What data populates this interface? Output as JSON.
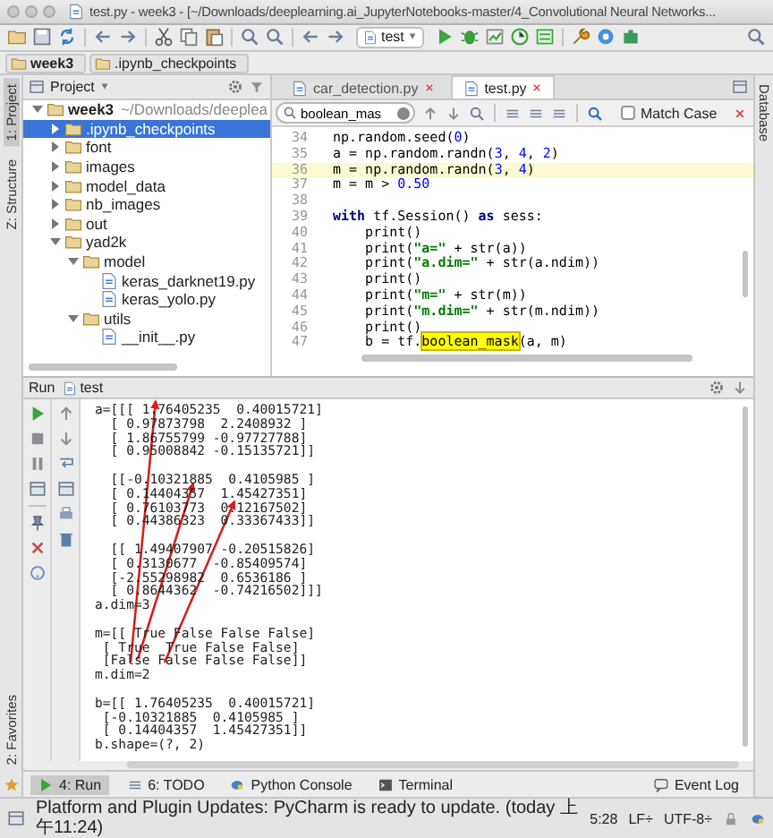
{
  "window": {
    "title": "test.py - week3 - [~/Downloads/deeplearning.ai_JupyterNotebooks-master/4_Convolutional Neural Networks..."
  },
  "toolbar": {
    "run_config": "test"
  },
  "breadcrumbs": [
    "week3",
    ".ipynb_checkpoints"
  ],
  "left_stripe": [
    {
      "label": "1: Project",
      "selected": true
    },
    {
      "label": "Z: Structure",
      "selected": false
    }
  ],
  "favorites": "2: Favorites",
  "right_stripe": [
    "Database"
  ],
  "project": {
    "title": "Project",
    "tree": [
      {
        "label": "week3",
        "path": "~/Downloads/deeplea",
        "kind": "folder",
        "expanded": true,
        "selected": false,
        "children": [
          {
            "label": ".ipynb_checkpoints",
            "kind": "folder",
            "expanded": false,
            "selected": true
          },
          {
            "label": "font",
            "kind": "folder",
            "expanded": false,
            "selected": false
          },
          {
            "label": "images",
            "kind": "folder",
            "expanded": false,
            "selected": false
          },
          {
            "label": "model_data",
            "kind": "folder",
            "expanded": false,
            "selected": false
          },
          {
            "label": "nb_images",
            "kind": "folder",
            "expanded": false,
            "selected": false
          },
          {
            "label": "out",
            "kind": "folder",
            "expanded": false,
            "selected": false
          },
          {
            "label": "yad2k",
            "kind": "folder",
            "expanded": true,
            "selected": false,
            "children": [
              {
                "label": "model",
                "kind": "folder",
                "expanded": true,
                "selected": false,
                "children": [
                  {
                    "label": "keras_darknet19.py",
                    "kind": "file",
                    "selected": false
                  },
                  {
                    "label": "keras_yolo.py",
                    "kind": "file",
                    "selected": false
                  }
                ]
              },
              {
                "label": "utils",
                "kind": "folder",
                "expanded": true,
                "selected": false,
                "children": [
                  {
                    "label": "__init__.py",
                    "kind": "file",
                    "selected": false
                  }
                ]
              }
            ]
          }
        ]
      }
    ]
  },
  "editor_tabs": [
    {
      "label": "car_detection.py",
      "selected": false
    },
    {
      "label": "test.py",
      "selected": true
    }
  ],
  "search": {
    "value": "boolean_mas",
    "match_case": {
      "label": "Match Case",
      "checked": false
    }
  },
  "code": [
    {
      "number": "34",
      "current": false,
      "tokens": [
        {
          "kind": "plain",
          "text": "np.random.seed("
        },
        {
          "kind": "number",
          "text": "0"
        },
        {
          "kind": "plain",
          "text": ")"
        }
      ]
    },
    {
      "number": "35",
      "current": false,
      "tokens": [
        {
          "kind": "plain",
          "text": "a = np.random.randn("
        },
        {
          "kind": "number",
          "text": "3"
        },
        {
          "kind": "plain",
          "text": ", "
        },
        {
          "kind": "number",
          "text": "4"
        },
        {
          "kind": "plain",
          "text": ", "
        },
        {
          "kind": "number",
          "text": "2"
        },
        {
          "kind": "plain",
          "text": ")"
        }
      ]
    },
    {
      "number": "36",
      "current": true,
      "tokens": [
        {
          "kind": "plain",
          "text": "m = np.random.randn("
        },
        {
          "kind": "number",
          "text": "3"
        },
        {
          "kind": "plain",
          "text": ", "
        },
        {
          "kind": "number",
          "text": "4"
        },
        {
          "kind": "plain",
          "text": ")"
        }
      ]
    },
    {
      "number": "37",
      "current": false,
      "tokens": [
        {
          "kind": "plain",
          "text": "m = m > "
        },
        {
          "kind": "number",
          "text": "0.50"
        }
      ]
    },
    {
      "number": "38",
      "current": false
    },
    {
      "number": "39",
      "current": false,
      "tokens": [
        {
          "kind": "keyword",
          "text": "with"
        },
        {
          "kind": "plain",
          "text": " tf.Session() "
        },
        {
          "kind": "keyword",
          "text": "as"
        },
        {
          "kind": "plain",
          "text": " sess:"
        }
      ]
    },
    {
      "number": "40",
      "current": false,
      "tokens": [
        {
          "kind": "plain",
          "text": "    print()"
        }
      ]
    },
    {
      "number": "41",
      "current": false,
      "tokens": [
        {
          "kind": "plain",
          "text": "    print("
        },
        {
          "kind": "string",
          "text": "\"a=\""
        },
        {
          "kind": "plain",
          "text": " + str(a))"
        }
      ]
    },
    {
      "number": "42",
      "current": false,
      "tokens": [
        {
          "kind": "plain",
          "text": "    print("
        },
        {
          "kind": "string",
          "text": "\"a.dim=\""
        },
        {
          "kind": "plain",
          "text": " + str(a.ndim))"
        }
      ]
    },
    {
      "number": "43",
      "current": false,
      "tokens": [
        {
          "kind": "plain",
          "text": "    print()"
        }
      ]
    },
    {
      "number": "44",
      "current": false,
      "tokens": [
        {
          "kind": "plain",
          "text": "    print("
        },
        {
          "kind": "string",
          "text": "\"m=\""
        },
        {
          "kind": "plain",
          "text": " + str(m))"
        }
      ]
    },
    {
      "number": "45",
      "current": false,
      "tokens": [
        {
          "kind": "plain",
          "text": "    print("
        },
        {
          "kind": "string",
          "text": "\"m.dim=\""
        },
        {
          "kind": "plain",
          "text": " + str(m.ndim))"
        }
      ]
    },
    {
      "number": "46",
      "current": false,
      "tokens": [
        {
          "kind": "plain",
          "text": "    print()"
        }
      ]
    },
    {
      "number": "47",
      "current": false,
      "tokens": [
        {
          "kind": "plain",
          "text": "    b = tf."
        },
        {
          "kind": "match",
          "text": "boolean_mask"
        },
        {
          "kind": "plain",
          "text": "(a, m)"
        }
      ]
    }
  ],
  "run": {
    "title": "Run",
    "config": "test",
    "output_blocks": [
      [
        "a=[[[ 1.76405235  0.40015721]",
        "  [ 0.97873798  2.2408932 ]",
        "  [ 1.86755799 -0.97727788]",
        "  [ 0.95008842 -0.15135721]]"
      ],
      [
        "  [[-0.10321885  0.4105985 ]",
        "  [ 0.14404357  1.45427351]",
        "  [ 0.76103773  0.12167502]",
        "  [ 0.44386323  0.33367433]]"
      ],
      [
        "  [[ 1.49407907 -0.20515826]",
        "  [ 0.3130677  -0.85409574]",
        "  [-2.55298982  0.6536186 ]",
        "  [ 0.8644362  -0.74216502]]]",
        "a.dim=3"
      ],
      [
        "m=[[ True False False False]",
        " [ True  True False False]",
        " [False False False False]]",
        "m.dim=2"
      ],
      [
        "b=[[ 1.76405235  0.40015721]",
        " [-0.10321885  0.4105985 ]",
        " [ 0.14404357  1.45427351]]",
        "b.shape=(?, 2)"
      ]
    ]
  },
  "tool_tabs": [
    {
      "label": "4: Run",
      "selected": true
    },
    {
      "label": "6: TODO",
      "selected": false
    },
    {
      "label": "Python Console",
      "selected": false
    },
    {
      "label": "Terminal",
      "selected": false
    }
  ],
  "event_log": "Event Log",
  "status_bar": {
    "message": "Platform and Plugin Updates: PyCharm is ready to update. (today 上午11:24)",
    "position": "5:28",
    "line_separator": "LF÷",
    "encoding": "UTF-8÷"
  }
}
